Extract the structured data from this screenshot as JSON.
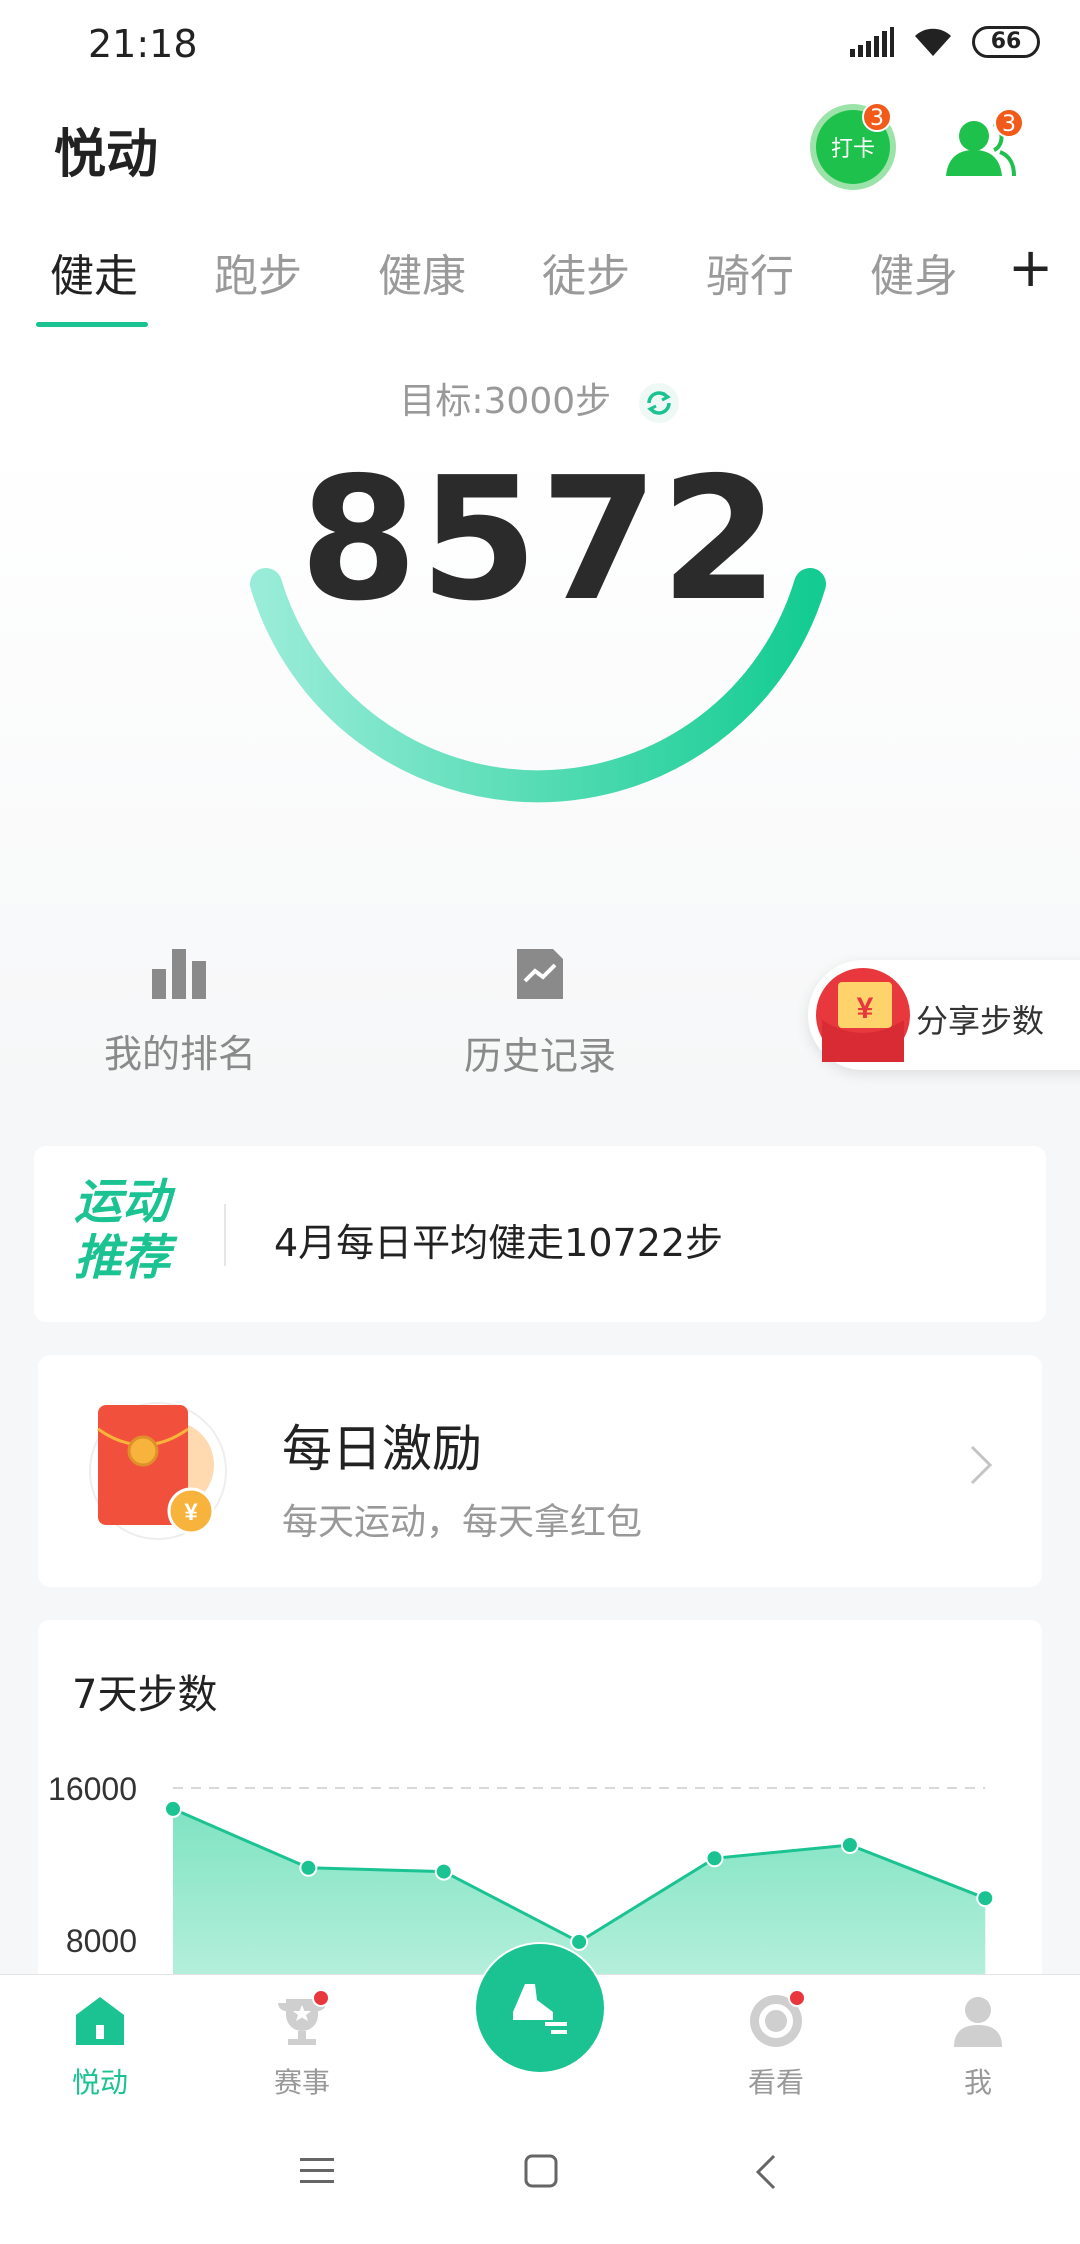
{
  "status_bar": {
    "time": "21:18",
    "battery": "66",
    "icons": [
      "signal-icon",
      "wifi-icon",
      "battery-icon"
    ]
  },
  "header": {
    "title": "悦动",
    "checkin_label": "打卡",
    "checkin_badge": "3",
    "friends_badge": "3"
  },
  "tabs": [
    {
      "label": "健走",
      "active": true
    },
    {
      "label": "跑步",
      "active": false
    },
    {
      "label": "健康",
      "active": false
    },
    {
      "label": "徒步",
      "active": false
    },
    {
      "label": "骑行",
      "active": false
    },
    {
      "label": "健身",
      "active": false
    }
  ],
  "tab_add_label": "+",
  "goal": {
    "label": "目标:3000步",
    "steps": "8572",
    "progress_fraction": 1.0
  },
  "quick_actions": {
    "ranking_label": "我的排名",
    "history_label": "历史记录",
    "share_label": "分享步数",
    "share_icon_symbol": "¥"
  },
  "recommend": {
    "title_line1": "运动",
    "title_line2": "推荐",
    "text": "4月每日平均健走10722步"
  },
  "incentive": {
    "title": "每日激励",
    "subtitle": "每天运动，每天拿红包",
    "coin_symbol": "¥"
  },
  "chart_data": {
    "type": "area",
    "title": "7天步数",
    "y_ticks": [
      "16000",
      "8000"
    ],
    "ylim": [
      0,
      16000
    ],
    "values": [
      14900,
      11800,
      11600,
      7900,
      12300,
      13000,
      10200
    ],
    "color": "#1ac391",
    "grid": "dashed"
  },
  "bottom_nav": {
    "items": [
      {
        "label": "悦动",
        "active": true,
        "icon": "home-icon"
      },
      {
        "label": "赛事",
        "active": false,
        "icon": "trophy-icon",
        "dot": true
      },
      {
        "label": "看看",
        "active": false,
        "icon": "watch-icon",
        "dot": true
      },
      {
        "label": "我",
        "active": false,
        "icon": "profile-icon"
      }
    ],
    "center_icon": "sport-shoe-icon"
  },
  "system_nav": {
    "icons": [
      "menu-icon",
      "home-square-icon",
      "back-icon"
    ]
  },
  "colors": {
    "accent": "#1ac391",
    "badge": "#f25a1a",
    "red": "#e8383e",
    "checkin_green": "#1ec14b"
  }
}
